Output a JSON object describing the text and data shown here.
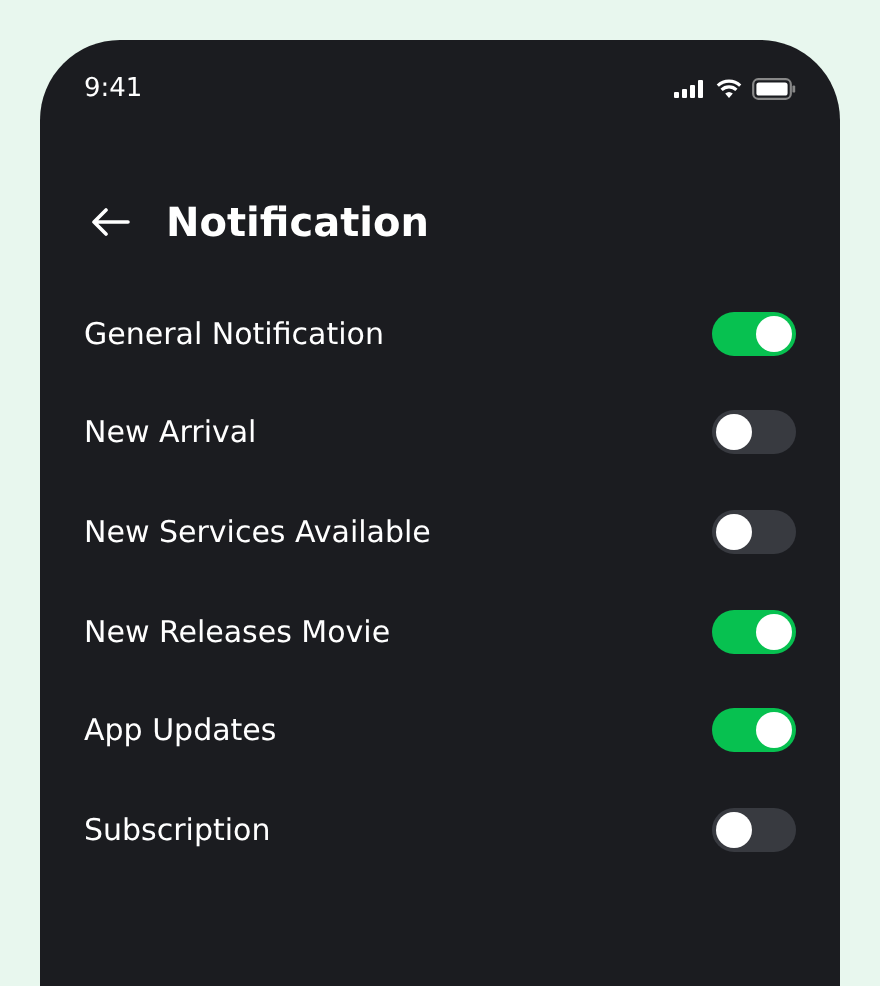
{
  "status_bar": {
    "time": "9:41"
  },
  "header": {
    "title": "Notification"
  },
  "settings": [
    {
      "label": "General Notification",
      "on": true
    },
    {
      "label": "New Arrival",
      "on": false
    },
    {
      "label": "New Services Available",
      "on": false
    },
    {
      "label": "New Releases Movie",
      "on": true
    },
    {
      "label": "App Updates",
      "on": true
    },
    {
      "label": "Subscription",
      "on": false
    }
  ]
}
